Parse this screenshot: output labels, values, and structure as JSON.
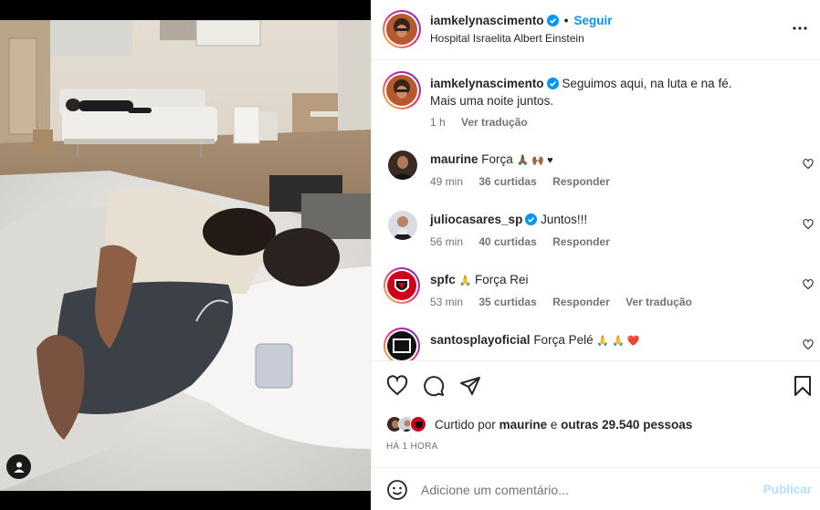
{
  "post": {
    "author": "iamkelynascimento",
    "follow_label": "Seguir",
    "location": "Hospital Israelita Albert Einstein"
  },
  "caption": {
    "author": "iamkelynascimento",
    "text_line1": "Seguimos aqui, na luta e na fé.",
    "text_line2": "Mais uma noite juntos.",
    "time": "1 h",
    "translate": "Ver tradução"
  },
  "comments": [
    {
      "user": "maurine",
      "text": "Força",
      "emojis": "🙏🏾 🙌🏾 ♥",
      "time": "49 min",
      "likes": "36 curtidas",
      "reply": "Responder",
      "translate": ""
    },
    {
      "user": "juliocasares_sp",
      "verified": true,
      "text": "Juntos!!!",
      "emojis": "",
      "time": "56 min",
      "likes": "40 curtidas",
      "reply": "Responder",
      "translate": ""
    },
    {
      "user": "spfc",
      "text": "Força Rei",
      "emojis": "🙏",
      "time": "53 min",
      "likes": "35 curtidas",
      "reply": "Responder",
      "translate": "Ver tradução"
    },
    {
      "user": "santosplayoficial",
      "text": "Força Pelé",
      "emojis": "🙏 🙏 ❤️",
      "time": "",
      "likes": "",
      "reply": "",
      "translate": ""
    }
  ],
  "likes": {
    "prefix": "Curtido por",
    "first_user": "maurine",
    "connector": "e",
    "others": "outras 29.540 pessoas"
  },
  "time_ago": "HÁ 1 HORA",
  "add_comment": {
    "placeholder": "Adicione um comentário...",
    "publish": "Publicar"
  },
  "colors": {
    "link_blue": "#0095f6",
    "publish_disabled": "#b2dffc",
    "verified_blue": "#0095f6",
    "muted": "#737373"
  },
  "icons": [
    "more-icon",
    "heart-icon",
    "comment-icon",
    "share-icon",
    "bookmark-icon",
    "emoji-icon",
    "user-tag-icon",
    "verified-icon"
  ]
}
